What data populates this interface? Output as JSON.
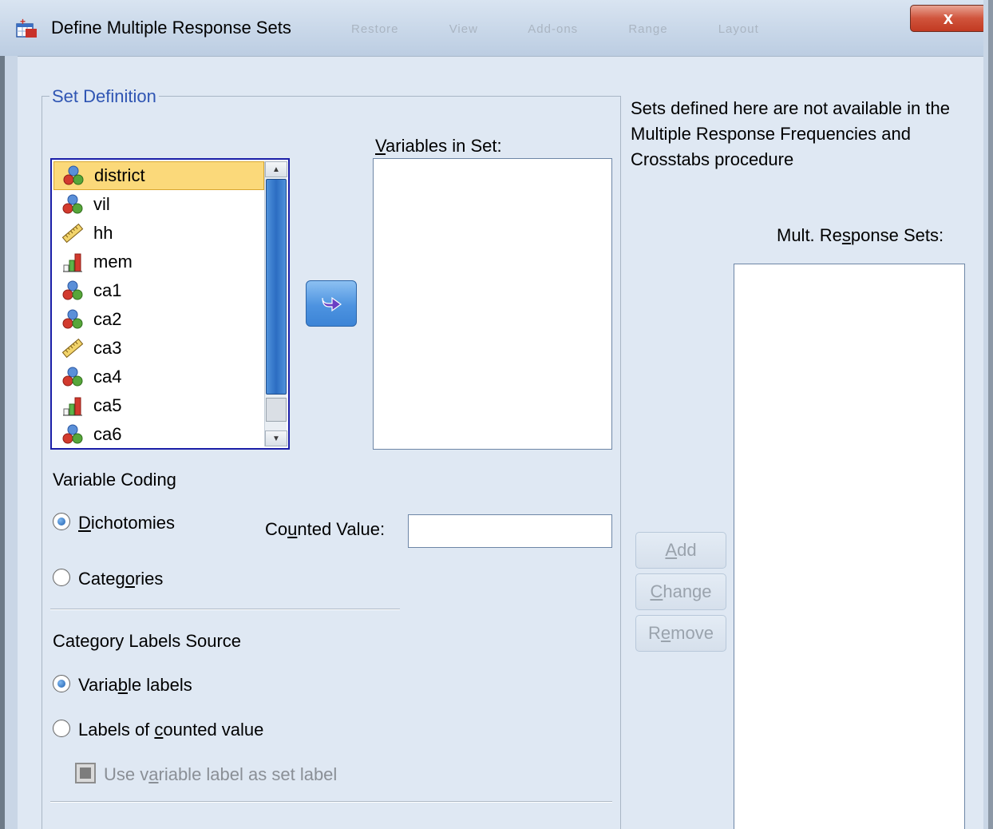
{
  "window": {
    "title": "Define Multiple Response Sets",
    "close_label": "x",
    "background_tabs": [
      "Restore",
      "View",
      "Add-ons",
      "Range",
      "Layout"
    ]
  },
  "set_definition": {
    "legend": "Set Definition",
    "variables": [
      {
        "name": "district",
        "icon": "nominal-icon",
        "selected": true
      },
      {
        "name": "vil",
        "icon": "nominal-icon"
      },
      {
        "name": "hh",
        "icon": "scale-icon"
      },
      {
        "name": "mem",
        "icon": "ordinal-icon"
      },
      {
        "name": "ca1",
        "icon": "nominal-icon"
      },
      {
        "name": "ca2",
        "icon": "nominal-icon"
      },
      {
        "name": "ca3",
        "icon": "scale-icon"
      },
      {
        "name": "ca4",
        "icon": "nominal-icon"
      },
      {
        "name": "ca5",
        "icon": "ordinal-icon"
      },
      {
        "name": "ca6",
        "icon": "nominal-icon"
      }
    ],
    "variables_in_set_label": "Variables in Set:",
    "variable_coding_label": "Variable Coding",
    "dichotomies_label": "Dichotomies",
    "categories_label": "Categories",
    "counted_value_label": "Counted Value:",
    "counted_value": "",
    "selected_coding": "Dichotomies",
    "category_labels_source_label": "Category Labels Source",
    "variable_labels_label": "Variable labels",
    "labels_of_counted_value_label": "Labels of counted value",
    "selected_labels_source": "Variable labels",
    "use_variable_label_label": "Use variable label as set label",
    "use_variable_label_checked": true,
    "use_variable_label_enabled": false
  },
  "note": {
    "text": "Sets defined here are not available in the Multiple Response Frequencies and Crosstabs procedure"
  },
  "mult_response": {
    "label": "Mult. Response Sets:",
    "buttons": {
      "add": "Add",
      "change": "Change",
      "remove": "Remove"
    },
    "buttons_enabled": false
  },
  "colors": {
    "accent_blue": "#2f55b3",
    "list_border": "#1b1fa8",
    "selection": "#fbd97a",
    "close_red": "#d0543c"
  }
}
